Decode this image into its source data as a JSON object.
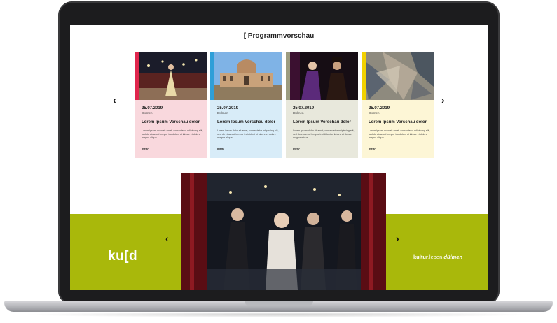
{
  "section": {
    "title": "[ Programmvorschau"
  },
  "cards": [
    {
      "date": "25.07.2019",
      "city": "Dülmen",
      "title": "Lorem Ipsum Vorschau dolor",
      "text": "Lorem ipsum dolor sit amet, consectetur adipiscing elit, sed do eiusmod tempor incididunt ut labore et dolore magna aliqua.",
      "more": "mehr",
      "bg": "#f9d8dd",
      "accent": "#e0264d"
    },
    {
      "date": "25.07.2019",
      "city": "Dülmen",
      "title": "Lorem Ipsum Vorschau dolor",
      "text": "Lorem ipsum dolor sit amet, consectetur adipiscing elit, sed do eiusmod tempor incididunt ut labore et dolore magna aliqua.",
      "more": "mehr",
      "bg": "#d8ecf8",
      "accent": "#2f9fd8"
    },
    {
      "date": "25.07.2019",
      "city": "Dülmen",
      "title": "Lorem Ipsum Vorschau dolor",
      "text": "Lorem ipsum dolor sit amet, consectetur adipiscing elit, sed do eiusmod tempor incididunt ut labore et dolore magna aliqua.",
      "more": "mehr",
      "bg": "#e8e8dc",
      "accent": "#9c9c80"
    },
    {
      "date": "25.07.2019",
      "city": "Dülmen",
      "title": "Lorem Ipsum Vorschau dolor",
      "text": "Lorem ipsum dolor sit amet, consectetur adipiscing elit, sed do eiusmod tempor incididunt ut labore et dolore magna aliqua.",
      "more": "mehr",
      "bg": "#fdf6d6",
      "accent": "#f2d100"
    }
  ],
  "icons": {
    "prev": "‹",
    "next": "›"
  },
  "brand": {
    "logo": "ku[d",
    "tagline_a": "kultur",
    "tagline_b": ".leben.",
    "tagline_c": "dülmen",
    "green": "#a9b80b"
  }
}
